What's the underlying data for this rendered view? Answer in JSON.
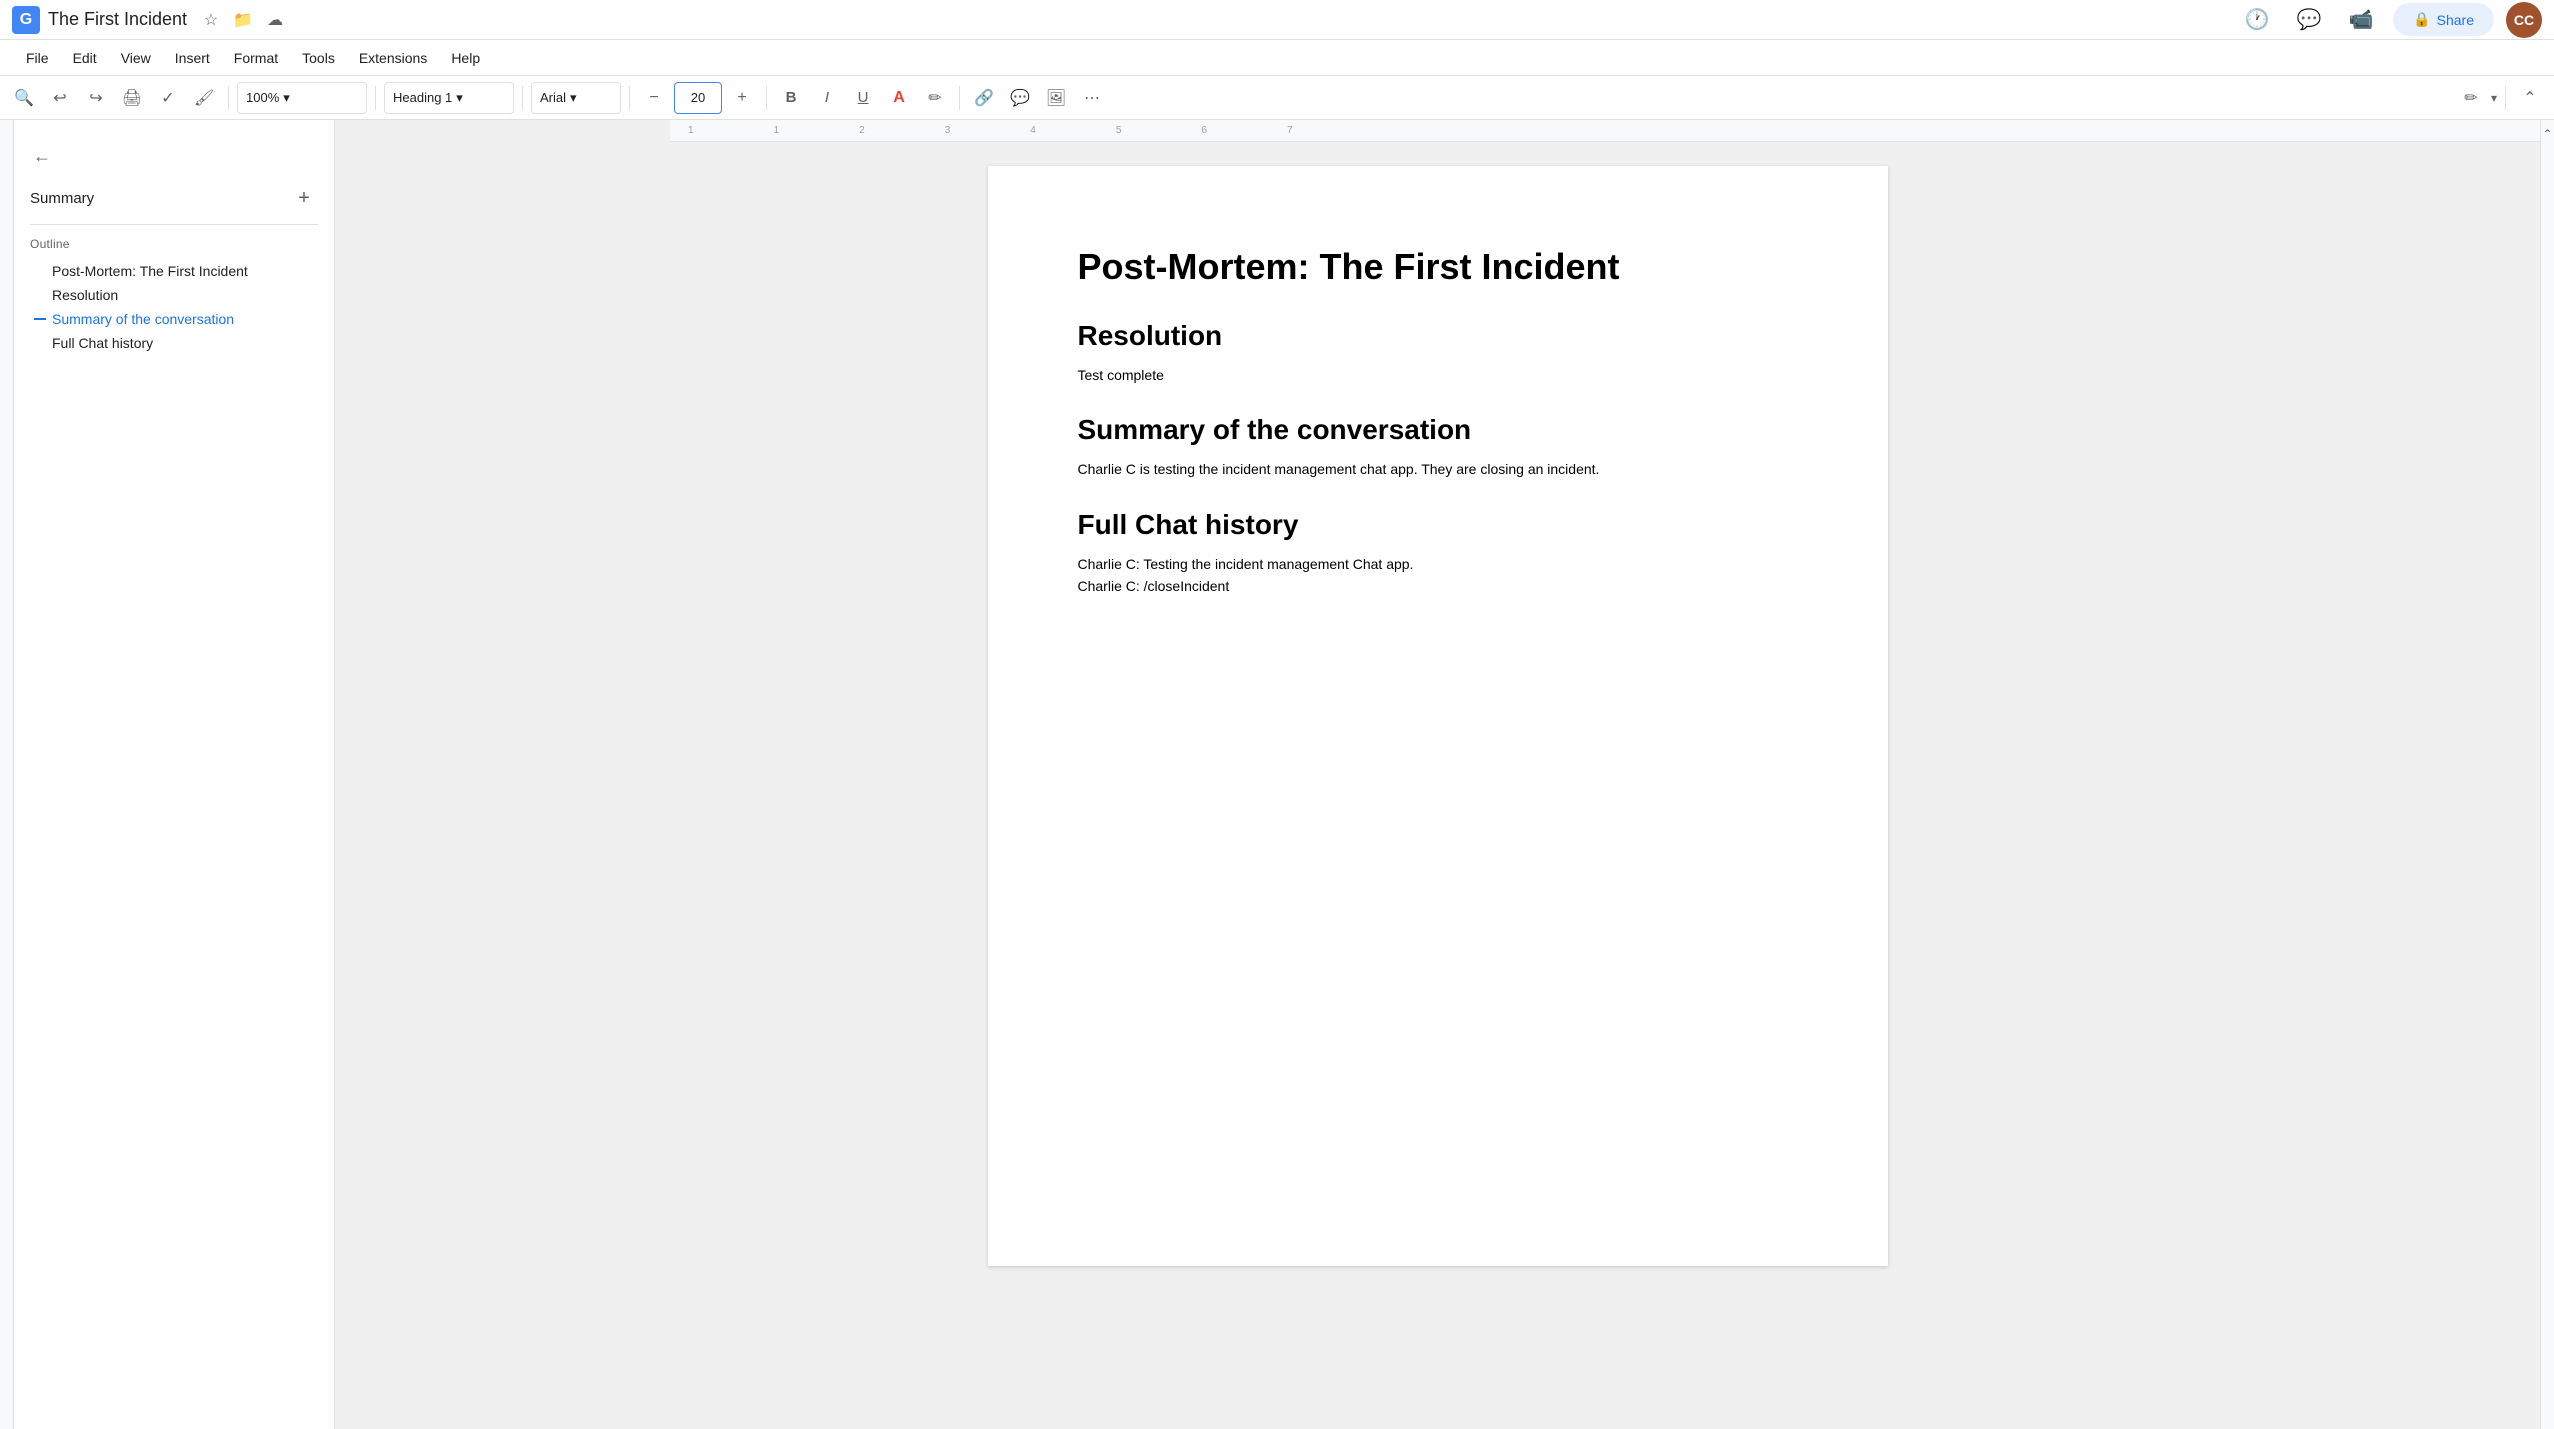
{
  "titleBar": {
    "appIconLabel": "G",
    "docTitle": "The First Incident",
    "starLabel": "☆",
    "folderLabel": "📁",
    "cloudLabel": "☁",
    "historyLabel": "🕐",
    "commentLabel": "💬",
    "videoLabel": "📹",
    "shareLabel": "Share",
    "avatarLabel": "CC"
  },
  "menuBar": {
    "items": [
      "File",
      "Edit",
      "View",
      "Insert",
      "Format",
      "Tools",
      "Extensions",
      "Help"
    ]
  },
  "toolbar": {
    "searchLabel": "🔍",
    "undoLabel": "↩",
    "redoLabel": "↪",
    "printLabel": "🖨",
    "spellLabel": "✓",
    "paintLabel": "🖌",
    "zoomValue": "100%",
    "zoomArrow": "▾",
    "styleValue": "Heading 1",
    "styleArrow": "▾",
    "fontValue": "Arial",
    "fontArrow": "▾",
    "fontSizeMinus": "−",
    "fontSizeValue": "20",
    "fontSizePlus": "+",
    "boldLabel": "B",
    "italicLabel": "I",
    "underlineLabel": "U",
    "textColorLabel": "A",
    "highlightLabel": "✏",
    "linkLabel": "🔗",
    "commentToolLabel": "💬",
    "imageLabel": "🖼",
    "moreLabel": "⋯",
    "editModeLabel": "✏",
    "editModeArrow": "▾",
    "collapseLabel": "⌃"
  },
  "outlinePanel": {
    "backLabel": "←",
    "summaryLabel": "Summary",
    "addLabel": "+",
    "outlineLabel": "Outline",
    "items": [
      {
        "text": "Post-Mortem: The First Incident",
        "active": false
      },
      {
        "text": "Resolution",
        "active": false
      },
      {
        "text": "Summary of the conversation",
        "active": true
      },
      {
        "text": "Full Chat history",
        "active": false
      }
    ]
  },
  "document": {
    "title": "Post-Mortem: The First Incident",
    "sections": [
      {
        "heading": "Resolution",
        "body": "Test complete"
      },
      {
        "heading": "Summary of the conversation",
        "body": "Charlie C is testing the incident management chat app. They are closing an incident."
      },
      {
        "heading": "Full Chat history",
        "lines": [
          "Charlie C: Testing the incident management Chat app.",
          "Charlie C: /closeIncident"
        ]
      }
    ]
  }
}
